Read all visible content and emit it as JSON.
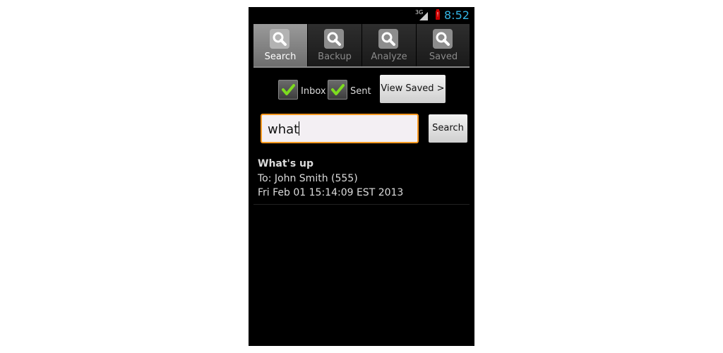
{
  "status_bar": {
    "network": "3G",
    "time": "8:52",
    "accent": "#33b5e5"
  },
  "tabs": [
    {
      "label": "Search",
      "icon": "search-icon",
      "active": true
    },
    {
      "label": "Backup",
      "icon": "search-icon",
      "active": false
    },
    {
      "label": "Analyze",
      "icon": "search-icon",
      "active": false
    },
    {
      "label": "Saved",
      "icon": "search-icon",
      "active": false
    }
  ],
  "filters": {
    "inbox_label": "Inbox",
    "inbox_checked": true,
    "sent_label": "Sent",
    "sent_checked": true,
    "view_saved_label": "View Saved >"
  },
  "search": {
    "value": "what",
    "button_label": "Search",
    "focus_color": "#ff9920"
  },
  "results": [
    {
      "title": "What's up",
      "recipient": "To: John Smith (555)",
      "date": "Fri Feb 01 15:14:09 EST 2013"
    }
  ]
}
